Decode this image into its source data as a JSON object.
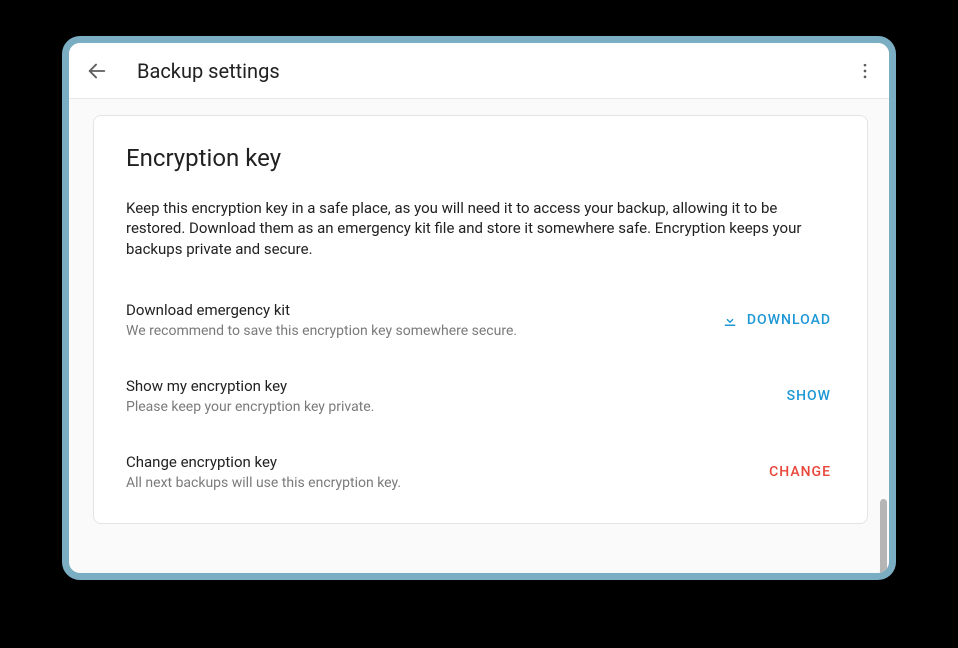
{
  "header": {
    "title": "Backup settings"
  },
  "card": {
    "title": "Encryption key",
    "description": "Keep this encryption key in a safe place, as you will need it to access your backup, allowing it to be restored. Download them as an emergency kit file and store it somewhere safe. Encryption keeps your backups private and secure."
  },
  "rows": {
    "download": {
      "label": "Download emergency kit",
      "sub": "We recommend to save this encryption key somewhere secure.",
      "action": "DOWNLOAD"
    },
    "show": {
      "label": "Show my encryption key",
      "sub": "Please keep your encryption key private.",
      "action": "SHOW"
    },
    "change": {
      "label": "Change encryption key",
      "sub": "All next backups will use this encryption key.",
      "action": "CHANGE"
    }
  }
}
